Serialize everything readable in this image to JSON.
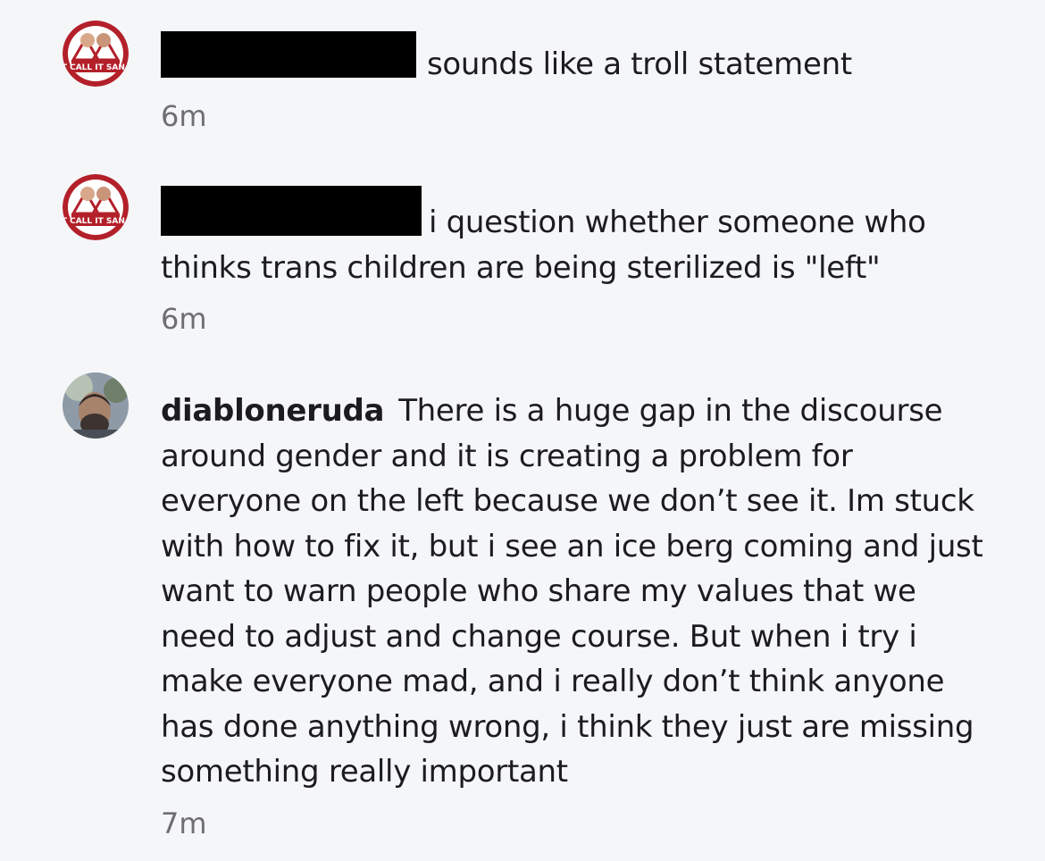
{
  "comments": [
    {
      "username": "",
      "username_redacted": true,
      "text": "sounds like a troll statement",
      "time": "6m",
      "avatar_icon": "san-fran-logo-avatar",
      "avatar_text": "DON'T CALL IT SAN FRAN"
    },
    {
      "username": "",
      "username_redacted": true,
      "text": "i question whether someone who thinks trans children are being sterilized is \"left\"",
      "time": "6m",
      "avatar_icon": "san-fran-logo-avatar",
      "avatar_text": "DON'T CALL IT SAN FRAN"
    },
    {
      "username": "diabloneruda",
      "username_redacted": false,
      "text": "There is a huge gap in the discourse around gender and it is creating a problem for everyone on the left because we don’t see it. Im stuck with how to fix it, but i see an ice berg coming and just want to warn people who share my values that we need to adjust and change course. But when i try i make everyone mad, and i really don’t think anyone has done anything wrong, i think they just are missing something really important",
      "time": "7m",
      "avatar_icon": "user-photo-avatar"
    }
  ],
  "colors": {
    "background": "#f5f6f8",
    "text": "#1c1c1f",
    "timestamp": "#6e6e73",
    "redaction": "#000000",
    "logo_red": "#b3202a"
  }
}
